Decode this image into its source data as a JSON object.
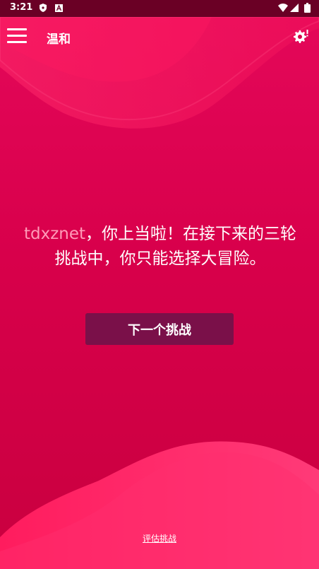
{
  "status_bar": {
    "time": "3:21",
    "icons": [
      "shield-icon",
      "a-badge-icon",
      "wifi-icon",
      "signal-icon",
      "battery-icon"
    ]
  },
  "app_bar": {
    "title": "温和",
    "menu_icon": "hamburger-menu-icon",
    "settings_icon": "settings-alert-icon"
  },
  "message": {
    "player_name": "tdxznet",
    "text": "，你上当啦！在接下来的三轮挑战中，你只能选择大冒险。"
  },
  "next_button": {
    "label": "下一个挑战"
  },
  "footer": {
    "evaluate_label": "评估挑战"
  },
  "colors": {
    "background": "#d8004b",
    "wave_light": "#ff2a6a",
    "button": "#7a1049",
    "player_name": "#ff9bb8",
    "status_bar": "#6a0025"
  }
}
